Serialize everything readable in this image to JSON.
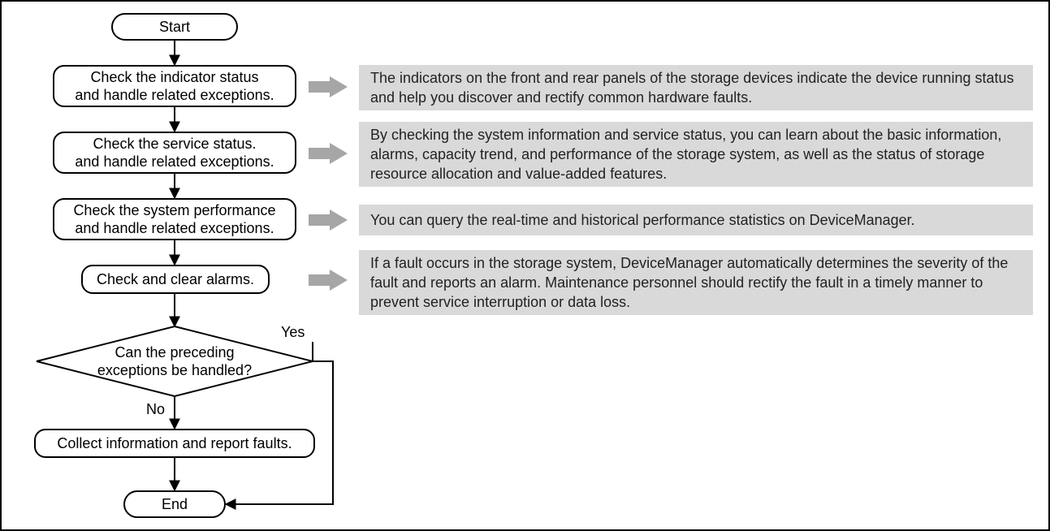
{
  "flow": {
    "start": "Start",
    "step1": "Check the indicator status\nand handle related exceptions.",
    "step2": "Check the service status.\nand handle related exceptions.",
    "step3": "Check the system performance\nand handle related exceptions.",
    "step4": "Check and clear alarms.",
    "decision": "Can the preceding\nexceptions be handled?",
    "decision_yes": "Yes",
    "decision_no": "No",
    "step5": "Collect information and report faults.",
    "end": "End"
  },
  "desc": {
    "d1": "The indicators on the front and rear panels of the storage devices indicate the device running status and help you discover and rectify common hardware faults.",
    "d2": "By checking the system information and service status, you can learn about the basic information, alarms, capacity trend, and performance of the storage system, as well as the status of storage resource allocation and value-added features.",
    "d3": "You can query the real-time and historical performance statistics on DeviceManager.",
    "d4": "If a fault occurs in the storage system, DeviceManager automatically determines the severity of the fault and reports an alarm. Maintenance personnel should rectify the fault in a timely manner to prevent service interruption or data loss."
  }
}
